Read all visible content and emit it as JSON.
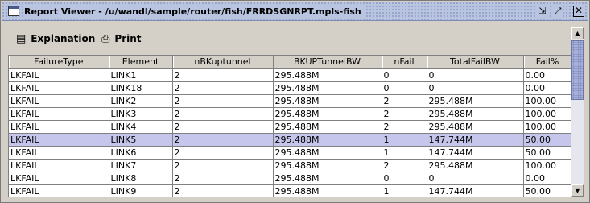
{
  "window": {
    "title": "Report Viewer - /u/wandl/sample/router/fish/FRRDSGNRPT.mpls-fish",
    "minimize_glyph": "⇲",
    "maximize_glyph": "⤢",
    "close_glyph": "✕"
  },
  "toolbar": {
    "explanation_label": "Explanation",
    "explanation_icon": "document-icon",
    "print_label": "Print",
    "print_icon": "printer-icon"
  },
  "table": {
    "columns": [
      "FailureType",
      "Element",
      "nBKuptunnel",
      "BKUPTunnelBW",
      "nFail",
      "TotalFailBW",
      "Fail%"
    ],
    "rows": [
      [
        "LKFAIL",
        "LINK1",
        "2",
        "295.488M",
        "0",
        "0",
        "0.00"
      ],
      [
        "LKFAIL",
        "LINK18",
        "2",
        "295.488M",
        "0",
        "0",
        "0.00"
      ],
      [
        "LKFAIL",
        "LINK2",
        "2",
        "295.488M",
        "2",
        "295.488M",
        "100.00"
      ],
      [
        "LKFAIL",
        "LINK3",
        "2",
        "295.488M",
        "2",
        "295.488M",
        "100.00"
      ],
      [
        "LKFAIL",
        "LINK4",
        "2",
        "295.488M",
        "2",
        "295.488M",
        "100.00"
      ],
      [
        "LKFAIL",
        "LINK5",
        "2",
        "295.488M",
        "1",
        "147.744M",
        "50.00"
      ],
      [
        "LKFAIL",
        "LINK6",
        "2",
        "295.488M",
        "1",
        "147.744M",
        "50.00"
      ],
      [
        "LKFAIL",
        "LINK7",
        "2",
        "295.488M",
        "2",
        "295.488M",
        "100.00"
      ],
      [
        "LKFAIL",
        "LINK8",
        "2",
        "295.488M",
        "0",
        "0",
        "0.00"
      ],
      [
        "LKFAIL",
        "LINK9",
        "2",
        "295.488M",
        "1",
        "147.744M",
        "50.00"
      ]
    ],
    "selected_row_index": 5
  },
  "colors": {
    "titlebar": "#b8c4e0",
    "selected_row": "#c6c6ec",
    "scroll_thumb": "#a8b0d8"
  }
}
